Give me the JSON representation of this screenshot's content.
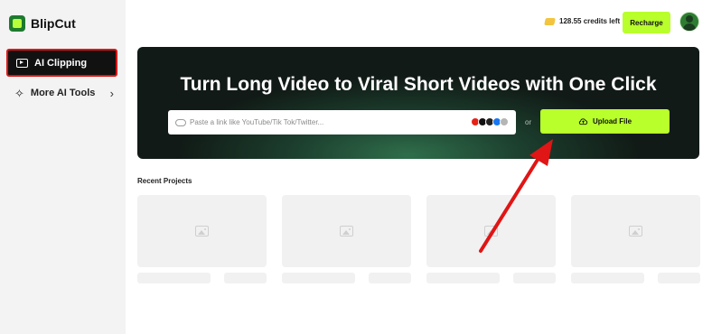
{
  "app": {
    "name": "BlipCut"
  },
  "sidebar": {
    "items": [
      {
        "label": "AI Clipping",
        "icon": "ai-clipping-icon",
        "active": true
      },
      {
        "label": "More AI Tools",
        "icon": "sparkle-icon",
        "active": false
      }
    ]
  },
  "header": {
    "credits_text": "128.55 credits left",
    "recharge_label": "Recharge"
  },
  "hero": {
    "title": "Turn Long Video to Viral Short Videos with One Click",
    "link_placeholder": "Paste a link like YouTube/Tik Tok/Twitter...",
    "or_text": "or",
    "upload_label": "Upload File",
    "platforms": [
      "youtube-icon",
      "tiktok-icon",
      "x-icon",
      "facebook-icon",
      "more-icon"
    ]
  },
  "recent": {
    "title": "Recent Projects",
    "placeholder_count": 4
  },
  "colors": {
    "accent": "#b8ff2c",
    "annotation": "#e01515",
    "sidebar_bg": "#f3f3f3"
  }
}
